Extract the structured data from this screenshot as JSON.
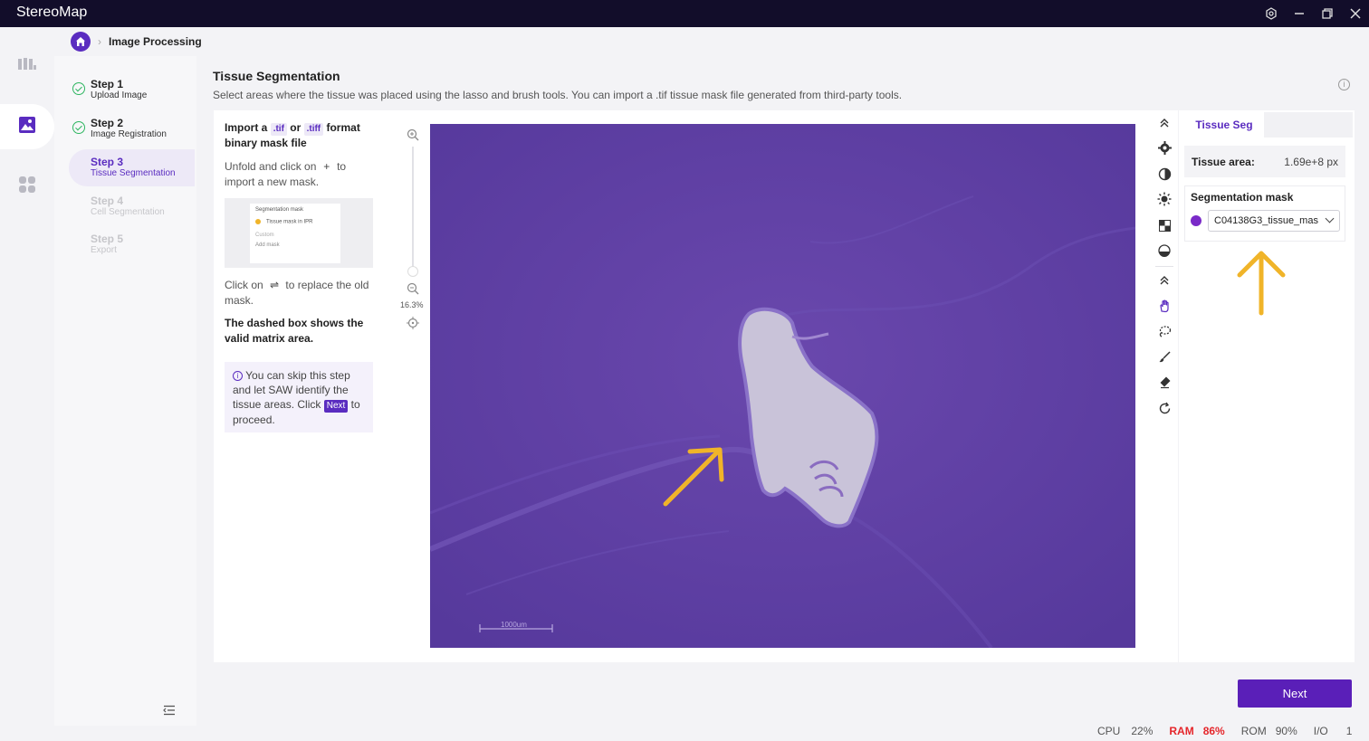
{
  "app": {
    "title": "StereoMap"
  },
  "breadcrumb": {
    "current": "Image Processing"
  },
  "steps": [
    {
      "title": "Step 1",
      "subtitle": "Upload Image",
      "state": "done"
    },
    {
      "title": "Step 2",
      "subtitle": "Image Registration",
      "state": "done"
    },
    {
      "title": "Step 3",
      "subtitle": "Tissue Segmentation",
      "state": "active"
    },
    {
      "title": "Step 4",
      "subtitle": "Cell Segmentation",
      "state": "disabled"
    },
    {
      "title": "Step 5",
      "subtitle": "Export",
      "state": "disabled"
    }
  ],
  "section": {
    "title": "Tissue Segmentation",
    "description": "Select areas where the tissue was placed using the lasso and brush tools. You can import a .tif tissue mask file generated from third-party tools."
  },
  "instructions": {
    "import_prefix": "Import a",
    "tif_tag": ".tif",
    "or_word": "or",
    "tiff_tag": ".tiff",
    "import_suffix": "format binary mask file",
    "unfold_a": "Unfold and click on",
    "plus_glyph": "+",
    "unfold_b": "to import a new mask.",
    "thumb_title": "Segmentation mask",
    "thumb_item": "Tissue mask in IPR",
    "thumb_custom": "Custom",
    "thumb_add": "Add mask",
    "replace_a": "Click on",
    "replace_glyph": "⇌",
    "replace_b": "to replace the old mask.",
    "dashed_note": "The dashed box shows the valid matrix area.",
    "skip_a": "You can skip this step and let SAW identify the tissue areas. Click",
    "skip_next": "Next",
    "skip_b": "to proceed."
  },
  "zoom": {
    "percent": "16.3%"
  },
  "viewer": {
    "scalebar_label": "1000um"
  },
  "right_panel": {
    "tab": "Tissue Seg",
    "area_label": "Tissue area:",
    "area_value": "1.69e+8 px",
    "mask_title": "Segmentation mask",
    "mask_value": "C04138G3_tissue_mas",
    "mask_color": "#7a2ac8"
  },
  "actions": {
    "next": "Next"
  },
  "statusbar": {
    "cpu_label": "CPU",
    "cpu_value": "22%",
    "ram_label": "RAM",
    "ram_value": "86%",
    "rom_label": "ROM",
    "rom_value": "90%",
    "io_label": "I/O",
    "io_value": "1"
  },
  "colors": {
    "accent": "#5a2cc0",
    "titlebar": "#120d2a",
    "arrow": "#f0b429",
    "ram_alert": "#e5262b"
  }
}
